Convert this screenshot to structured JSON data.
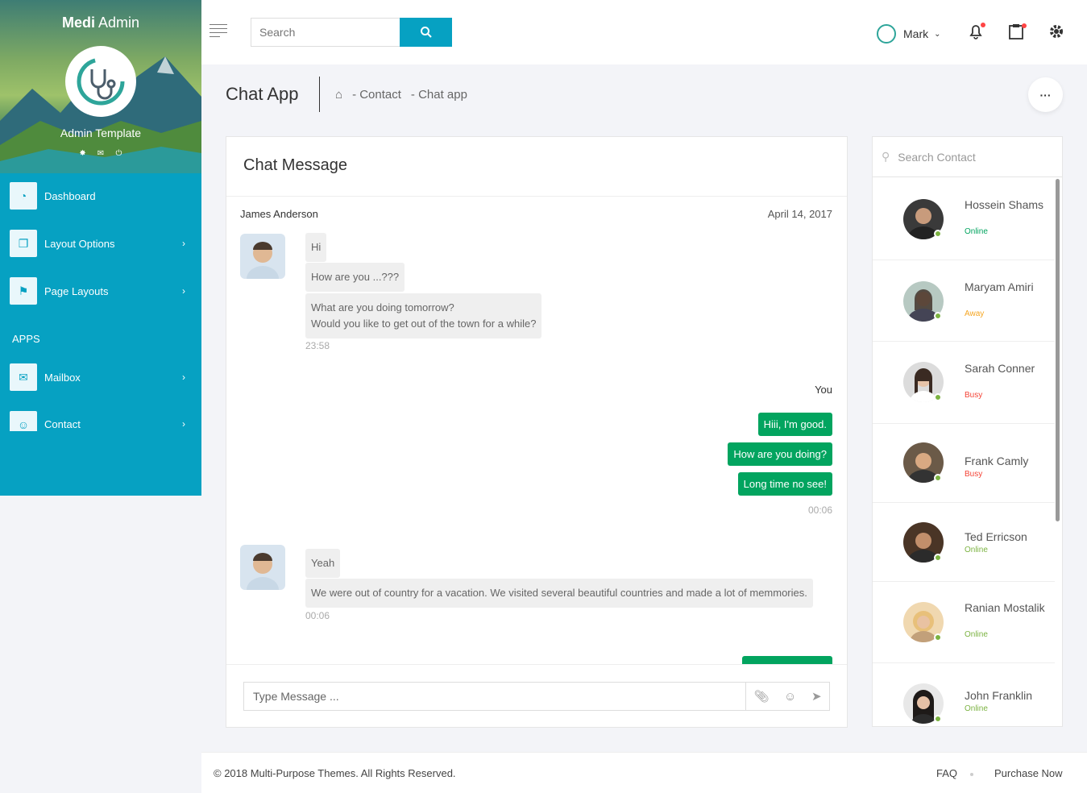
{
  "sidebar": {
    "brand_bold": "Medi",
    "brand_rest": " Admin",
    "subtitle": "Admin Template",
    "menu": [
      {
        "label": "Dashboard",
        "icon": "dashboard-icon"
      },
      {
        "label": "Layout Options",
        "icon": "layout-icon"
      },
      {
        "label": "Page Layouts",
        "icon": "signpost-icon"
      },
      {
        "label": "Mailbox",
        "icon": "mail-icon"
      },
      {
        "label": "Contact",
        "icon": "user-icon"
      }
    ],
    "section_apps": "APPS"
  },
  "topbar": {
    "search_placeholder": "Search",
    "user_name": "Mark"
  },
  "page_header": {
    "title": "Chat App",
    "crumbs": [
      "- Contact",
      "- Chat app"
    ]
  },
  "chat": {
    "title": "Chat Message",
    "sender": "James Anderson",
    "date": "April 14, 2017",
    "group1": [
      "Hi",
      "How are you ...???",
      "What are you doing tomorrow?",
      "Would you like to get out of the town for a while?"
    ],
    "time1": "23:58",
    "you_label": "You",
    "group2": [
      "Hiii, I'm good.",
      "How are you doing?",
      "Long time no see!"
    ],
    "time2": "00:06",
    "group3": [
      "Yeah",
      "We were out of country for a vacation. We visited several beautiful countries and made a lot of memmories."
    ],
    "time3": "00:06",
    "input_placeholder": "Type Message ..."
  },
  "contacts": {
    "search_placeholder": "Search Contact",
    "list": [
      {
        "name": "Hossein Shams",
        "status": "Online",
        "color": "#02a45f"
      },
      {
        "name": "Maryam Amiri",
        "status": "Away",
        "color": "#f5a623"
      },
      {
        "name": "Sarah Conner",
        "status": "Busy",
        "color": "#f44336"
      },
      {
        "name": "Frank Camly",
        "status": "Busy",
        "color": "#f44336"
      },
      {
        "name": "Ted Erricson",
        "status": "Online",
        "color": "#7cb342"
      },
      {
        "name": "Ranian Mostalik",
        "status": "Online",
        "color": "#7cb342"
      },
      {
        "name": "John Franklin",
        "status": "Online",
        "color": "#7cb342"
      }
    ]
  },
  "footer": {
    "copyright": "© 2018 Multi-Purpose Themes. All Rights Reserved.",
    "faq": "FAQ",
    "purchase": "Purchase Now"
  },
  "colors": {
    "accent": "#06a1c2",
    "outgoing": "#02a45f"
  }
}
